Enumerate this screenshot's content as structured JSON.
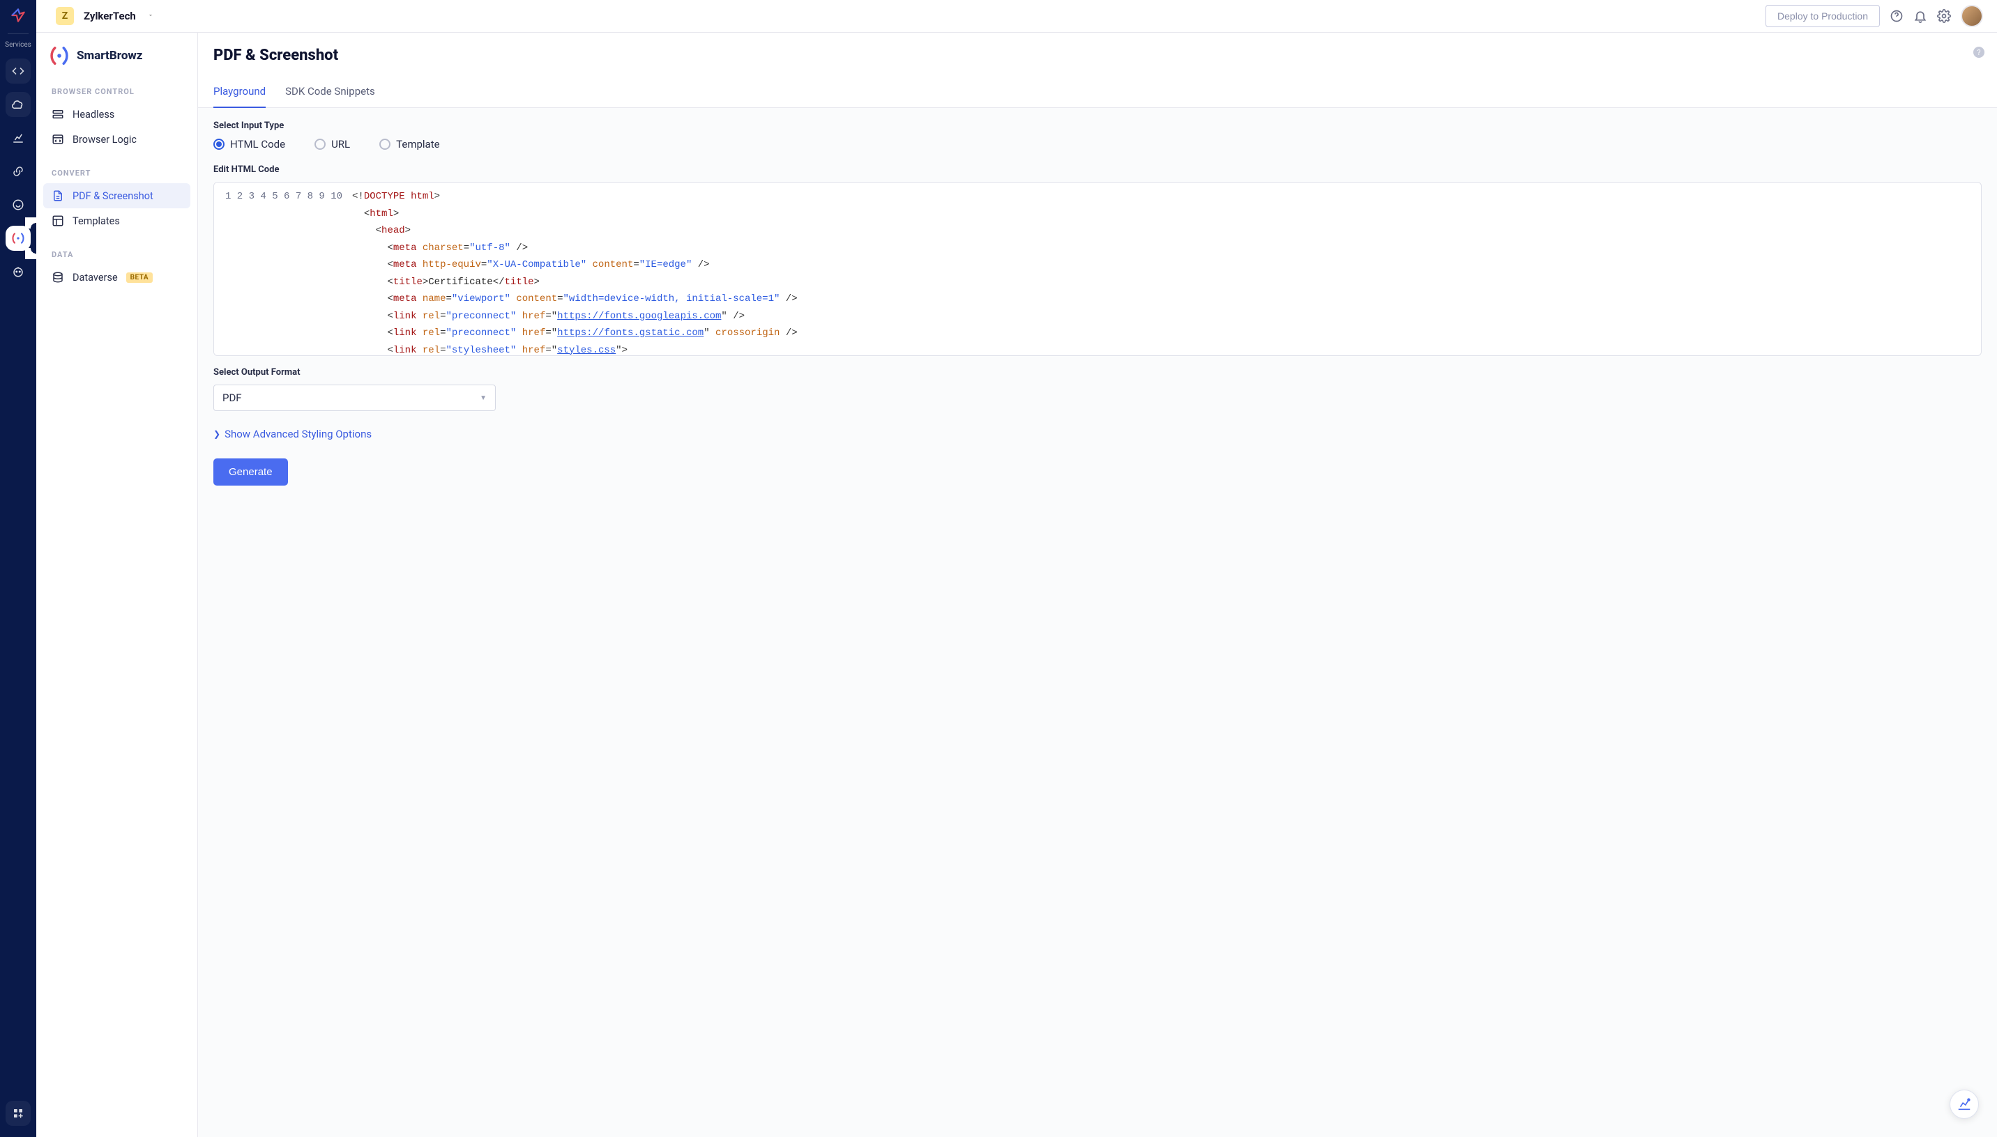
{
  "workspace": {
    "initial": "Z",
    "name": "ZylkerTech"
  },
  "topbar": {
    "deploy_label": "Deploy to Production"
  },
  "rail": {
    "services_label": "Services"
  },
  "product": {
    "name": "SmartBrowz"
  },
  "sidebar": {
    "sections": [
      {
        "title": "BROWSER CONTROL",
        "items": [
          "Headless",
          "Browser Logic"
        ]
      },
      {
        "title": "CONVERT",
        "items": [
          "PDF & Screenshot",
          "Templates"
        ]
      },
      {
        "title": "DATA",
        "items": [
          "Dataverse"
        ],
        "badges": [
          "BETA"
        ]
      }
    ]
  },
  "page": {
    "title": "PDF & Screenshot",
    "tabs": [
      "Playground",
      "SDK Code Snippets"
    ],
    "active_tab": 0
  },
  "form": {
    "input_type_label": "Select Input Type",
    "input_types": [
      "HTML Code",
      "URL",
      "Template"
    ],
    "selected_input_type": 0,
    "edit_label": "Edit HTML Code",
    "output_format_label": "Select Output Format",
    "output_format_value": "PDF",
    "advanced_label": "Show Advanced Styling Options",
    "generate_label": "Generate"
  },
  "code": {
    "line_numbers": [
      "1",
      "2",
      "3",
      "4",
      "5",
      "6",
      "7",
      "8",
      "9",
      "10"
    ],
    "lines": [
      {
        "indent": 0,
        "tokens": [
          [
            "punc",
            "<!"
          ],
          [
            "doc",
            "DOCTYPE "
          ],
          [
            "tag",
            "html"
          ],
          [
            "punc",
            ">"
          ]
        ]
      },
      {
        "indent": 1,
        "tokens": [
          [
            "punc",
            "<"
          ],
          [
            "tag",
            "html"
          ],
          [
            "punc",
            ">"
          ]
        ]
      },
      {
        "indent": 2,
        "tokens": [
          [
            "punc",
            "<"
          ],
          [
            "tag",
            "head"
          ],
          [
            "punc",
            ">"
          ]
        ]
      },
      {
        "indent": 3,
        "tokens": [
          [
            "punc",
            "<"
          ],
          [
            "tag",
            "meta "
          ],
          [
            "attr",
            "charset"
          ],
          [
            "punc",
            "="
          ],
          [
            "str",
            "\"utf-8\""
          ],
          [
            "punc",
            " />"
          ]
        ]
      },
      {
        "indent": 3,
        "tokens": [
          [
            "punc",
            "<"
          ],
          [
            "tag",
            "meta "
          ],
          [
            "attr",
            "http-equiv"
          ],
          [
            "punc",
            "="
          ],
          [
            "str",
            "\"X-UA-Compatible\""
          ],
          [
            "punc",
            " "
          ],
          [
            "attr",
            "content"
          ],
          [
            "punc",
            "="
          ],
          [
            "str",
            "\"IE=edge\""
          ],
          [
            "punc",
            " />"
          ]
        ]
      },
      {
        "indent": 3,
        "tokens": [
          [
            "punc",
            "<"
          ],
          [
            "tag",
            "title"
          ],
          [
            "punc",
            ">"
          ],
          [
            "text",
            "Certificate"
          ],
          [
            "punc",
            "</"
          ],
          [
            "tag",
            "title"
          ],
          [
            "punc",
            ">"
          ]
        ]
      },
      {
        "indent": 3,
        "tokens": [
          [
            "punc",
            "<"
          ],
          [
            "tag",
            "meta "
          ],
          [
            "attr",
            "name"
          ],
          [
            "punc",
            "="
          ],
          [
            "str",
            "\"viewport\""
          ],
          [
            "punc",
            " "
          ],
          [
            "attr",
            "content"
          ],
          [
            "punc",
            "="
          ],
          [
            "str",
            "\"width=device-width, initial-scale=1\""
          ],
          [
            "punc",
            " />"
          ]
        ]
      },
      {
        "indent": 3,
        "tokens": [
          [
            "punc",
            "<"
          ],
          [
            "tag",
            "link "
          ],
          [
            "attr",
            "rel"
          ],
          [
            "punc",
            "="
          ],
          [
            "str",
            "\"preconnect\""
          ],
          [
            "punc",
            " "
          ],
          [
            "attr",
            "href"
          ],
          [
            "punc",
            "=\""
          ],
          [
            "link",
            "https://fonts.googleapis.com"
          ],
          [
            "punc",
            "\" />"
          ]
        ]
      },
      {
        "indent": 3,
        "tokens": [
          [
            "punc",
            "<"
          ],
          [
            "tag",
            "link "
          ],
          [
            "attr",
            "rel"
          ],
          [
            "punc",
            "="
          ],
          [
            "str",
            "\"preconnect\""
          ],
          [
            "punc",
            " "
          ],
          [
            "attr",
            "href"
          ],
          [
            "punc",
            "=\""
          ],
          [
            "link",
            "https://fonts.gstatic.com"
          ],
          [
            "punc",
            "\" "
          ],
          [
            "attr",
            "crossorigin"
          ],
          [
            "punc",
            " />"
          ]
        ]
      },
      {
        "indent": 3,
        "tokens": [
          [
            "punc",
            "<"
          ],
          [
            "tag",
            "link "
          ],
          [
            "attr",
            "rel"
          ],
          [
            "punc",
            "="
          ],
          [
            "str",
            "\"stylesheet\""
          ],
          [
            "punc",
            " "
          ],
          [
            "attr",
            "href"
          ],
          [
            "punc",
            "=\""
          ],
          [
            "link",
            "styles.css"
          ],
          [
            "punc",
            "\">"
          ]
        ]
      }
    ]
  }
}
